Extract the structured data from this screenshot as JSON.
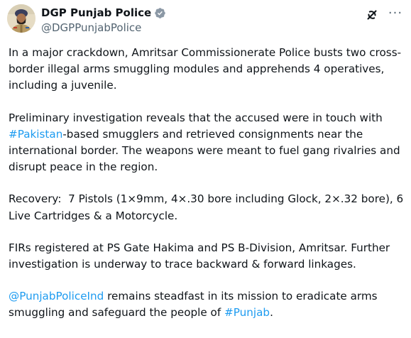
{
  "author": {
    "display_name": "DGP Punjab Police",
    "handle": "@DGPPunjabPolice",
    "verified": true,
    "verified_color": "#8b98a5",
    "avatar_icon": "officer-avatar"
  },
  "actions": {
    "grok_icon": "grok-icon",
    "more_label": "···"
  },
  "colors": {
    "text": "#0f1419",
    "secondary": "#536471",
    "link": "#1d9bf0"
  },
  "tweet": {
    "p1": "In a major crackdown, Amritsar Commissionerate Police busts two cross-border illegal arms smuggling modules and apprehends 4 operatives, including a juvenile.",
    "p2_pre": "Preliminary investigation reveals that the accused were in touch with ",
    "p2_hashtag": "#Pakistan",
    "p2_post": "-based smugglers and retrieved consignments near the international border. The weapons were meant to fuel gang rivalries and disrupt peace in the region.",
    "p3": "Recovery:  7 Pistols (1×9mm, 4×.30 bore including Glock, 2×.32 bore), 6 Live Cartridges & a Motorcycle.",
    "p4": "FIRs registered at PS Gate Hakima and PS B-Division, Amritsar. Further investigation is underway to trace backward & forward linkages.",
    "p5_mention": "@PunjabPoliceInd",
    "p5_mid": " remains steadfast in its mission to eradicate arms smuggling and safeguard the people of ",
    "p5_hashtag": "#Punjab",
    "p5_end": "."
  }
}
